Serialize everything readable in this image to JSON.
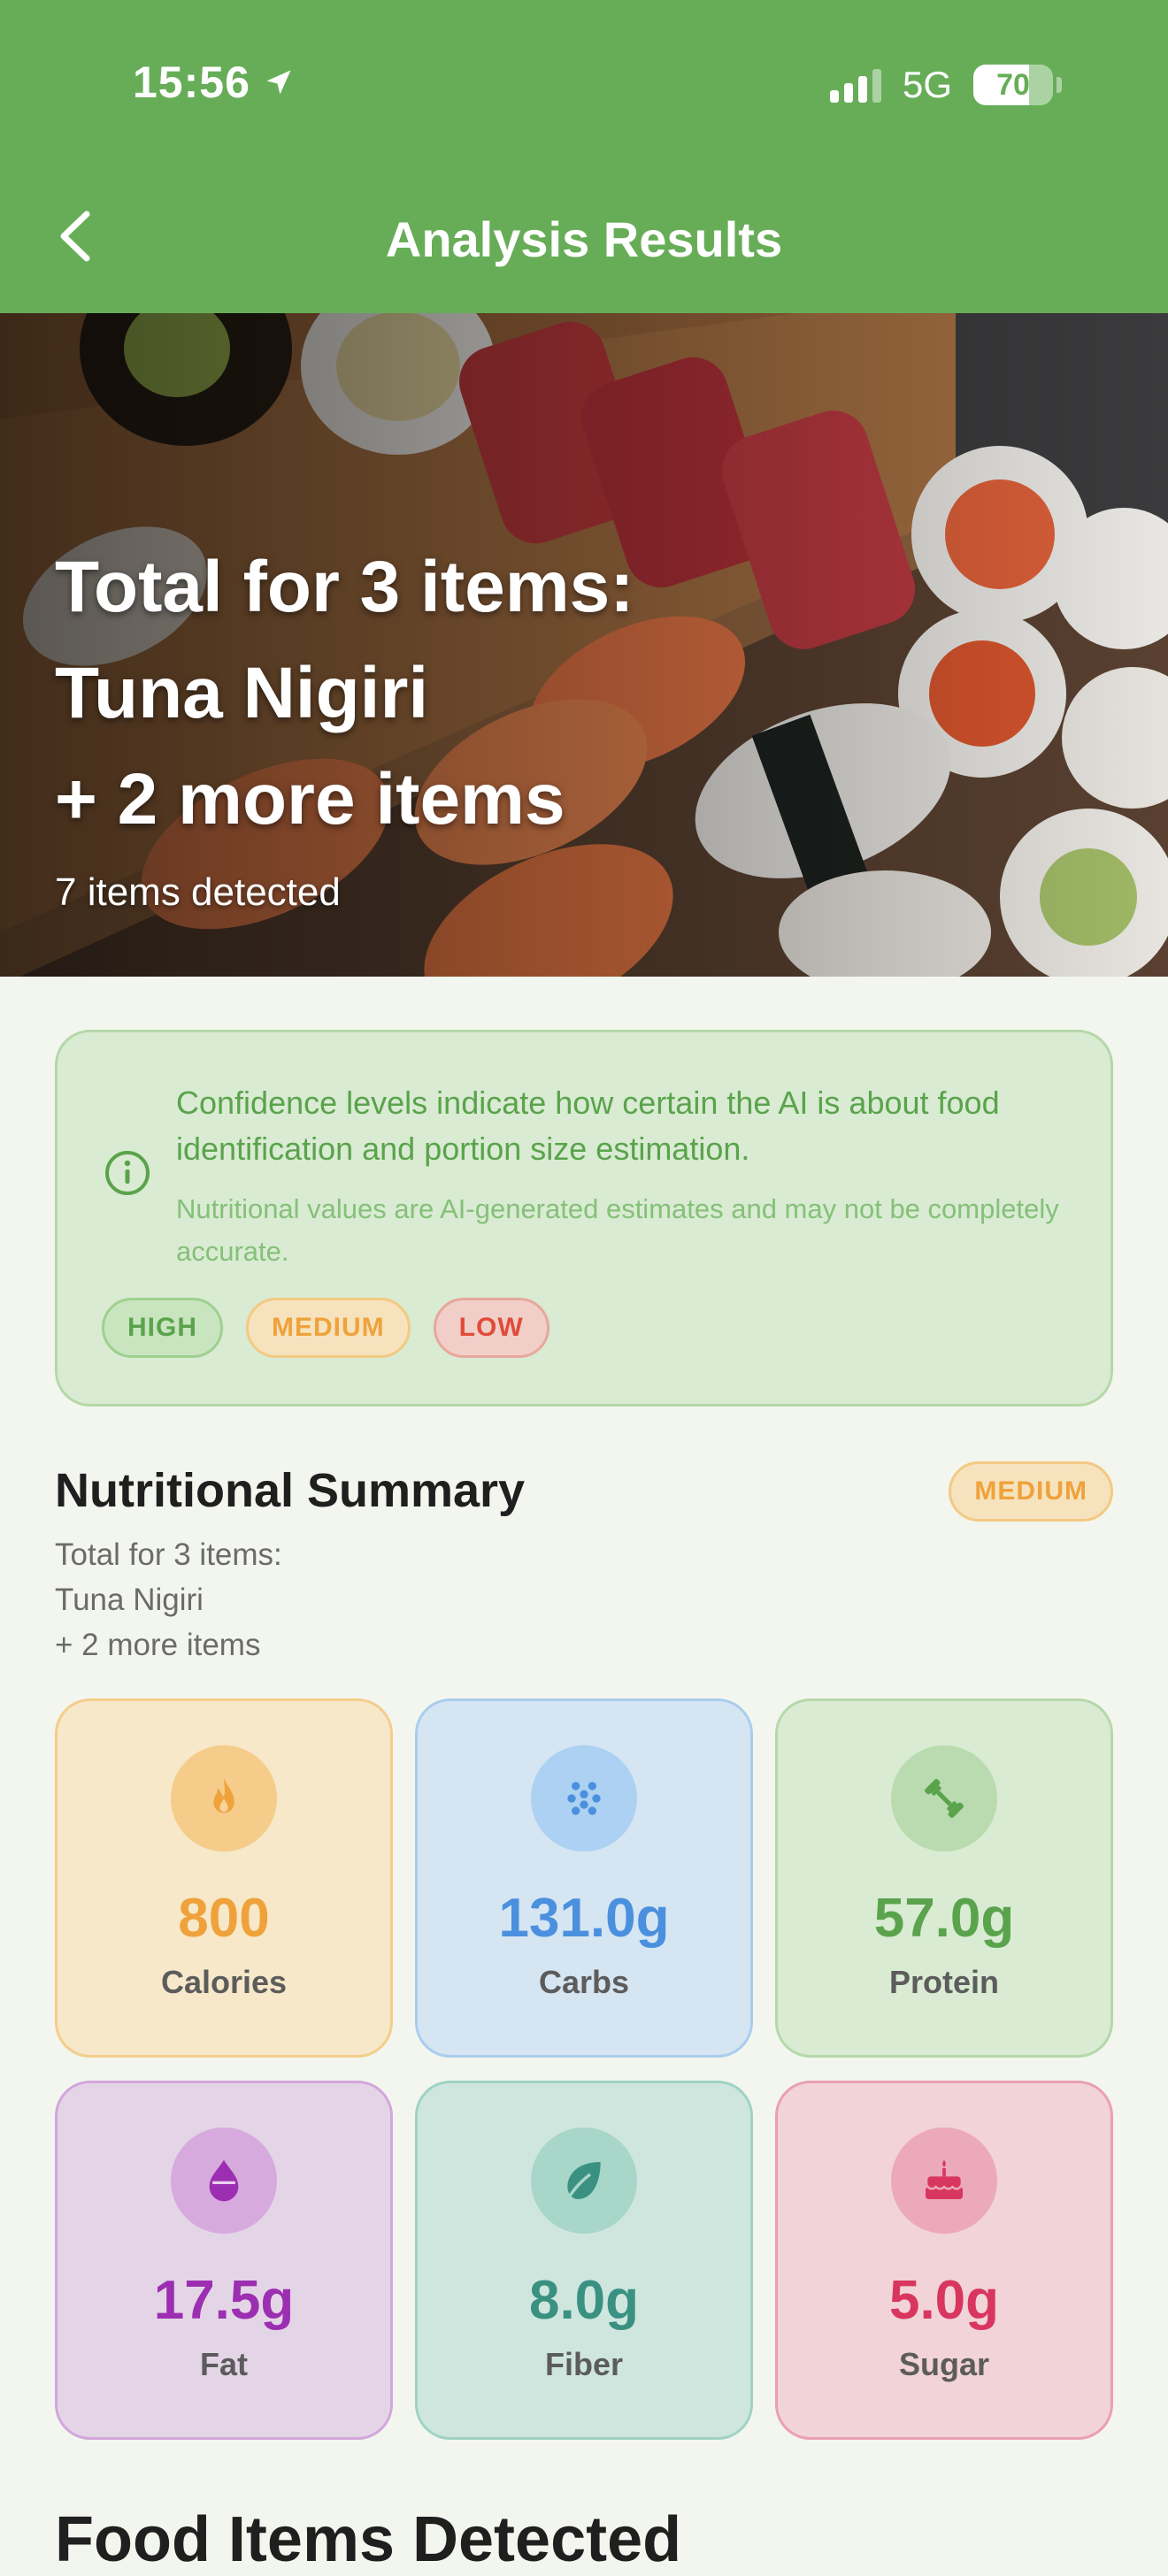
{
  "status_bar": {
    "time": "15:56",
    "network": "5G",
    "battery": "70",
    "battery_level": 0.7
  },
  "header": {
    "title": "Analysis Results"
  },
  "hero": {
    "line1": "Total for 3 items:",
    "line2": "Tuna Nigiri",
    "line3": "+ 2 more items",
    "subtitle": "7 items detected"
  },
  "info": {
    "main": "Confidence levels indicate how certain the AI is about food identification and portion size estimation.",
    "note": "Nutritional values are AI-generated estimates and may not be completely accurate.",
    "chips": {
      "high": "HIGH",
      "medium": "MEDIUM",
      "low": "LOW"
    }
  },
  "summary": {
    "title": "Nutritional Summary",
    "badge": "MEDIUM",
    "sub1": "Total for 3 items:",
    "sub2": "Tuna Nigiri",
    "sub3": "+ 2 more items"
  },
  "nutrients": {
    "calories": {
      "value": "800",
      "label": "Calories",
      "icon": "flame-icon",
      "color": "#efa23b"
    },
    "carbs": {
      "value": "131.0g",
      "label": "Carbs",
      "icon": "grain-icon",
      "color": "#4b90de"
    },
    "protein": {
      "value": "57.0g",
      "label": "Protein",
      "icon": "dumbbell-icon",
      "color": "#5aa34c"
    },
    "fat": {
      "value": "17.5g",
      "label": "Fat",
      "icon": "droplet-icon",
      "color": "#9c2eb1"
    },
    "fiber": {
      "value": "8.0g",
      "label": "Fiber",
      "icon": "leaf-icon",
      "color": "#3a9182"
    },
    "sugar": {
      "value": "5.0g",
      "label": "Sugar",
      "icon": "cake-icon",
      "color": "#d8365f"
    }
  },
  "next_section": {
    "title": "Food Items Detected"
  },
  "colors": {
    "brand": "#67ad58",
    "background": "#f3f6ee"
  }
}
